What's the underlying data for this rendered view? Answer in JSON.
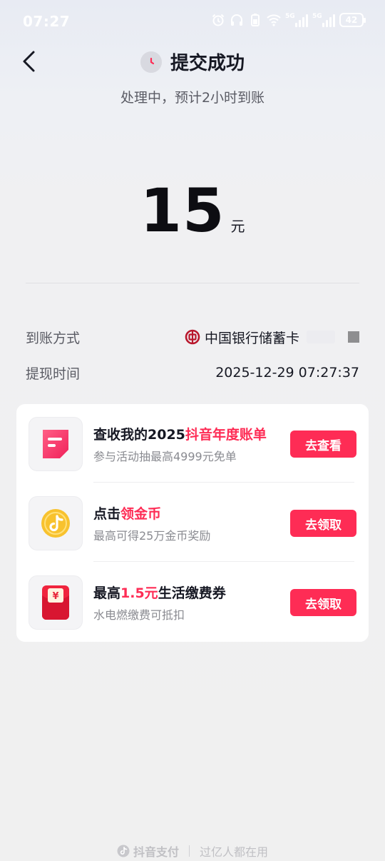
{
  "status_bar": {
    "time": "07:27",
    "network_1": "5G",
    "network_2": "5G",
    "battery": "42"
  },
  "header": {
    "title": "提交成功",
    "subtitle": "处理中，预计2小时到账"
  },
  "amount": {
    "value": "15",
    "unit": "元"
  },
  "details": {
    "method_label": "到账方式",
    "method_value": "中国银行储蓄卡",
    "time_label": "提现时间",
    "time_value": "2025-12-29 07:27:37"
  },
  "tasks": [
    {
      "title_prefix": "查收我的2025",
      "title_highlight": "抖音年度账单",
      "title_suffix": "",
      "desc": "参与活动抽最高4999元免单",
      "button": "去查看",
      "icon": "annual-bill-icon"
    },
    {
      "title_prefix": "点击",
      "title_highlight": "领金币",
      "title_suffix": "",
      "desc": "最高可得25万金币奖励",
      "button": "去领取",
      "icon": "gold-coin-icon"
    },
    {
      "title_prefix": "最高",
      "title_highlight": "1.5元",
      "title_suffix": "生活缴费券",
      "desc": "水电燃缴费可抵扣",
      "button": "去领取",
      "icon": "red-envelope-icon"
    }
  ],
  "footer": {
    "brand": "抖音支付",
    "slogan": "过亿人都在用"
  },
  "colors": {
    "accent": "#fe2c55",
    "coin": "#f8c22e",
    "bank": "#b8162c"
  }
}
